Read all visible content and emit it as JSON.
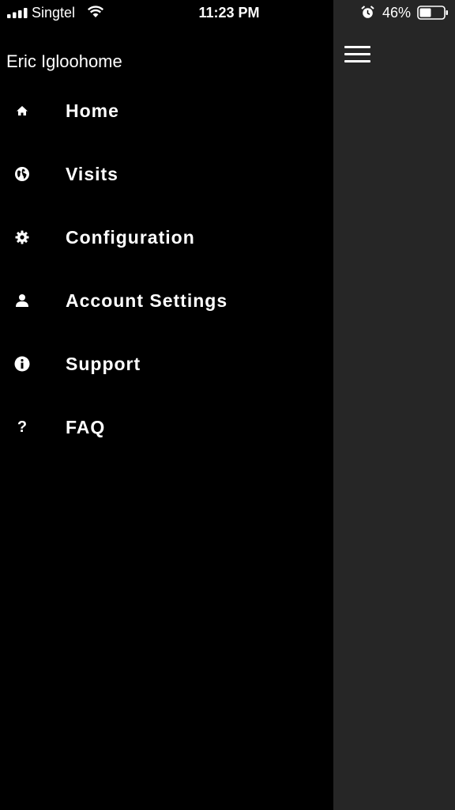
{
  "status_bar": {
    "carrier": "Singtel",
    "time": "11:23 PM",
    "battery_percent": "46%"
  },
  "drawer": {
    "user_name": "Eric Igloohome",
    "items": [
      {
        "label": "Home",
        "icon": "home-icon"
      },
      {
        "label": "Visits",
        "icon": "globe-icon"
      },
      {
        "label": "Configuration",
        "icon": "gear-icon"
      },
      {
        "label": "Account Settings",
        "icon": "user-icon"
      },
      {
        "label": "Support",
        "icon": "info-icon"
      },
      {
        "label": "FAQ",
        "icon": "question-icon",
        "glyph": "?"
      }
    ]
  },
  "colors": {
    "drawer_bg": "#000000",
    "overlay_bg": "#262626",
    "text": "#ffffff"
  }
}
